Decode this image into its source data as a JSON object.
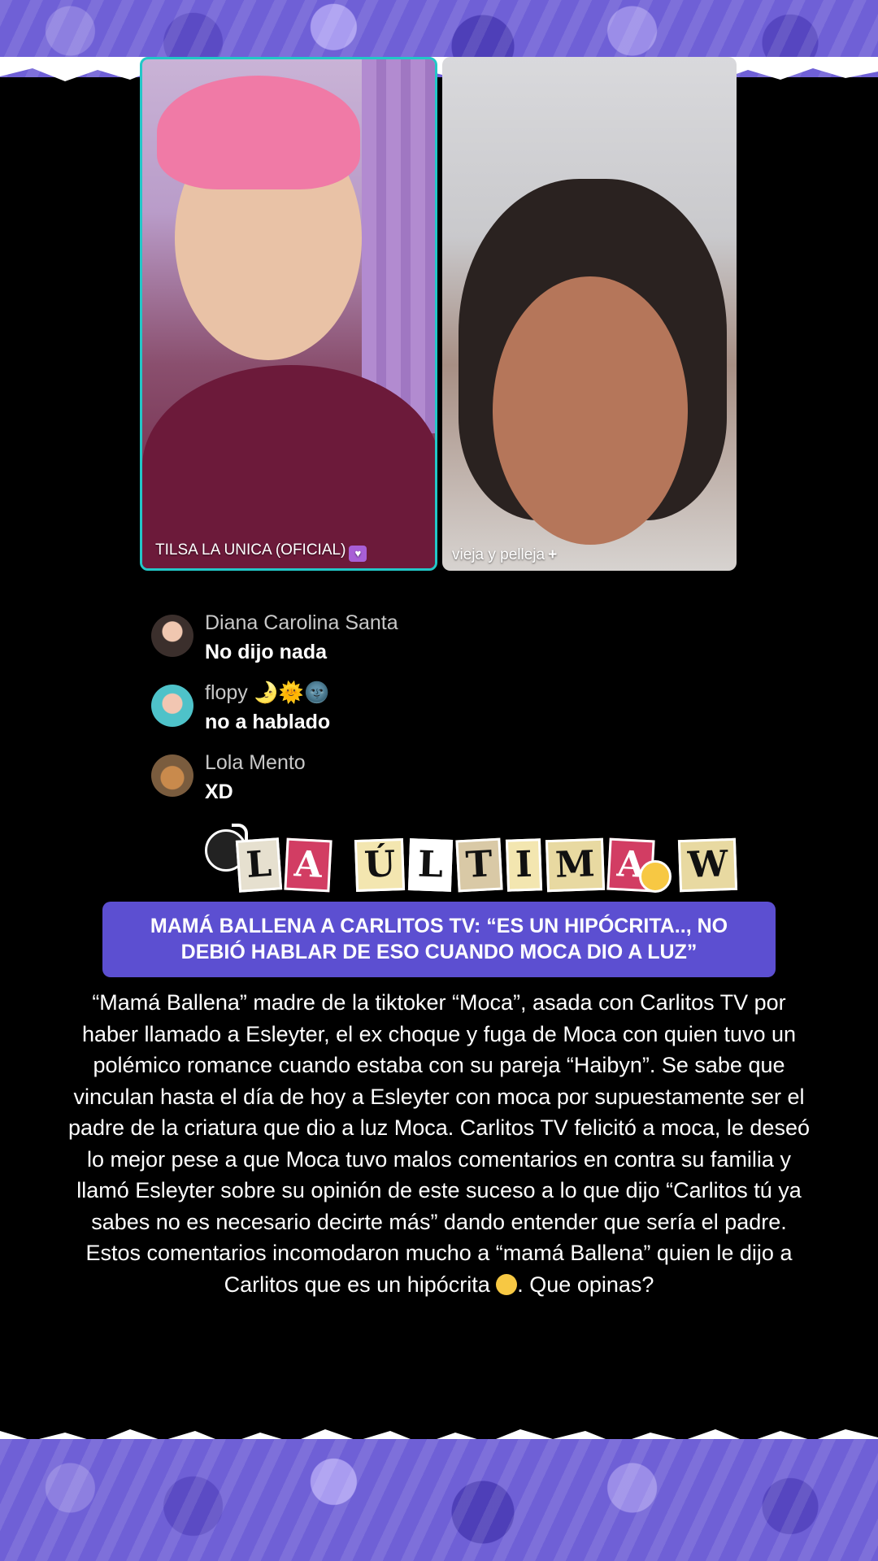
{
  "video": {
    "left_label": "TILSA LA UNICA (OFICIAL)",
    "left_badge_icon": "heart-icon",
    "right_label": "vieja y pelleja",
    "right_action_icon": "plus-icon"
  },
  "comments": [
    {
      "user": "Diana Carolina Santa",
      "text": "No dijo nada"
    },
    {
      "user": "flopy 🌛🌞🌚",
      "text": "no a hablado"
    },
    {
      "user": "Lola Mento",
      "text": "XD"
    }
  ],
  "logo": {
    "letters": [
      "L",
      "A",
      "Ú",
      "L",
      "T",
      "I",
      "M",
      "A",
      "W"
    ],
    "words": [
      "LA",
      "ÚLTIMA",
      "W"
    ]
  },
  "headline": "MAMÁ BALLENA A CARLITOS TV: “ES UN HIPÓCRITA.., NO DEBIÓ HABLAR DE ESO CUANDO MOCA DIO A LUZ”",
  "article": {
    "body": "“Mamá Ballena” madre de la tiktoker “Moca”, asada con Carlitos TV por haber llamado a Esleyter, el ex choque y fuga de Moca con quien tuvo un polémico romance cuando estaba con su pareja “Haibyn”. Se sabe que vinculan hasta el día de hoy a Esleyter con moca por supuestamente ser el padre de la criatura que dio a luz Moca. Carlitos TV felicitó a moca, le deseó lo mejor pese a que Moca tuvo malos comentarios en contra su familia y llamó Esleyter sobre su opinión de este suceso a lo que dijo “Carlitos tú ya sabes no es necesario decirte más” dando entender que sería el padre. Estos comentarios incomodaron mucho a “mamá Ballena” quien le dijo a Carlitos que es un hipócrita",
    "ending": ". Que opinas?",
    "emoji_icon": "surprised-face-icon"
  },
  "colors": {
    "banner": "#6f60d6",
    "headline_bg": "#5c4fd1",
    "cam_border": "#22c7c7"
  }
}
